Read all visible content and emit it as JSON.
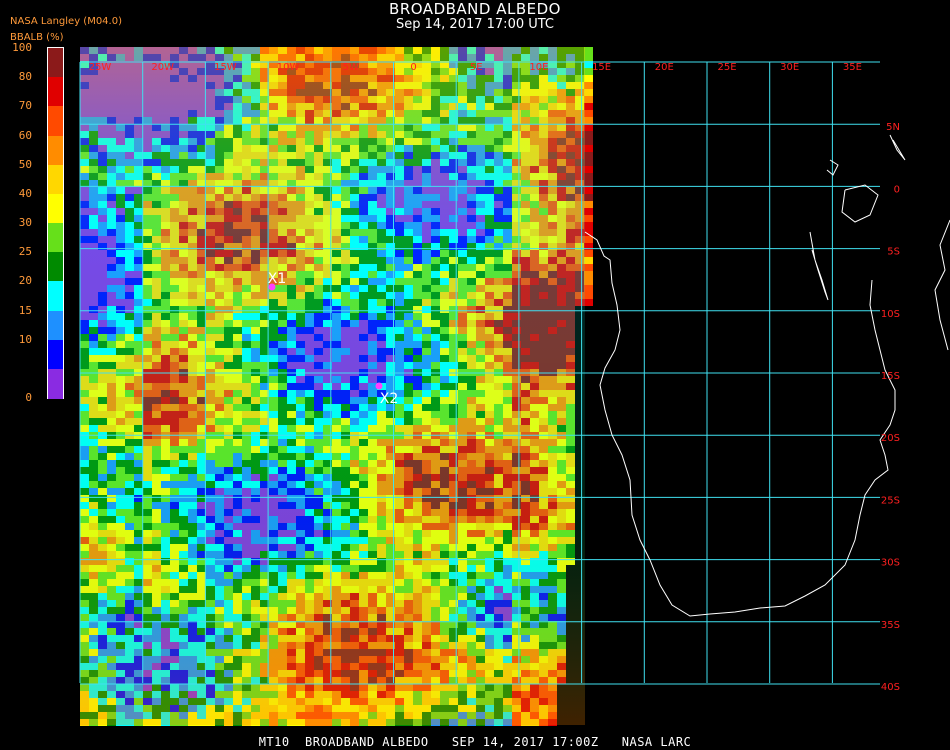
{
  "header": {
    "title": "BROADBAND ALBEDO",
    "subtitle": "Sep 14, 2017 17:00 UTC",
    "credit": "NASA Langley (M04.0)",
    "units_label": "BBALB (%)"
  },
  "colorbar": {
    "tick_labels": [
      "100",
      "80",
      "70",
      "60",
      "50",
      "40",
      "30",
      "25",
      "20",
      "15",
      "10",
      "0"
    ],
    "colors": [
      "#8b1a1a",
      "#e00000",
      "#ff4a00",
      "#ff8c00",
      "#ffd700",
      "#ffff00",
      "#66e01a",
      "#008a00",
      "#00ffff",
      "#1e90ff",
      "#0000ff",
      "#8a2be2"
    ]
  },
  "map": {
    "grid_color": "#40e0f0",
    "coast_color": "#ffffff",
    "lon_labels": [
      "25W",
      "20W",
      "15W",
      "10W",
      "5W",
      "0",
      "5E",
      "10E",
      "15E",
      "20E",
      "25E",
      "30E",
      "35E"
    ],
    "lat_labels": [
      "5N",
      "0",
      "5S",
      "10S",
      "15S",
      "20S",
      "25S",
      "30S",
      "35S",
      "40S"
    ],
    "label_color": "#ff2020",
    "markers": [
      {
        "id": "X1",
        "label": "X1",
        "color": "#ff40ff"
      },
      {
        "id": "X2",
        "label": "X2",
        "color": "#ff40ff"
      }
    ]
  },
  "footer": {
    "text": "MT10  BROADBAND ALBEDO   SEP 14, 2017 17:00Z   NASA LARC"
  }
}
